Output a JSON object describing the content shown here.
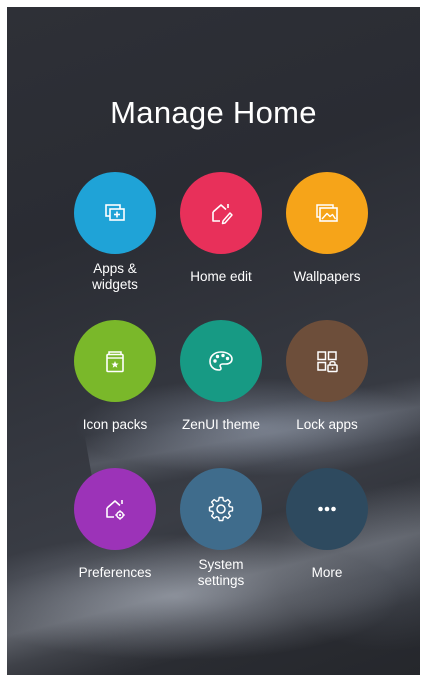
{
  "title": "Manage Home",
  "items": [
    {
      "label": "Apps & widgets",
      "label_lines": [
        "Apps &",
        "widgets"
      ],
      "icon": "apps-widgets-icon",
      "color": "#1fa3d7"
    },
    {
      "label": "Home edit",
      "label_lines": [
        "Home edit"
      ],
      "icon": "home-edit-icon",
      "color": "#e8305a"
    },
    {
      "label": "Wallpapers",
      "label_lines": [
        "Wallpapers"
      ],
      "icon": "wallpapers-icon",
      "color": "#f6a419"
    },
    {
      "label": "Icon packs",
      "label_lines": [
        "Icon packs"
      ],
      "icon": "icon-packs-icon",
      "color": "#7ab82a"
    },
    {
      "label": "ZenUI theme",
      "label_lines": [
        "ZenUI theme"
      ],
      "icon": "palette-icon",
      "color": "#179a84"
    },
    {
      "label": "Lock apps",
      "label_lines": [
        "Lock apps"
      ],
      "icon": "lock-apps-icon",
      "color": "#6d4e3a"
    },
    {
      "label": "Preferences",
      "label_lines": [
        "Preferences"
      ],
      "icon": "preferences-icon",
      "color": "#9c33b8"
    },
    {
      "label": "System settings",
      "label_lines": [
        "System",
        "settings"
      ],
      "icon": "gear-icon",
      "color": "#3f6c8c"
    },
    {
      "label": "More",
      "label_lines": [
        "More"
      ],
      "icon": "more-icon",
      "color": "#2e4a5f"
    }
  ]
}
